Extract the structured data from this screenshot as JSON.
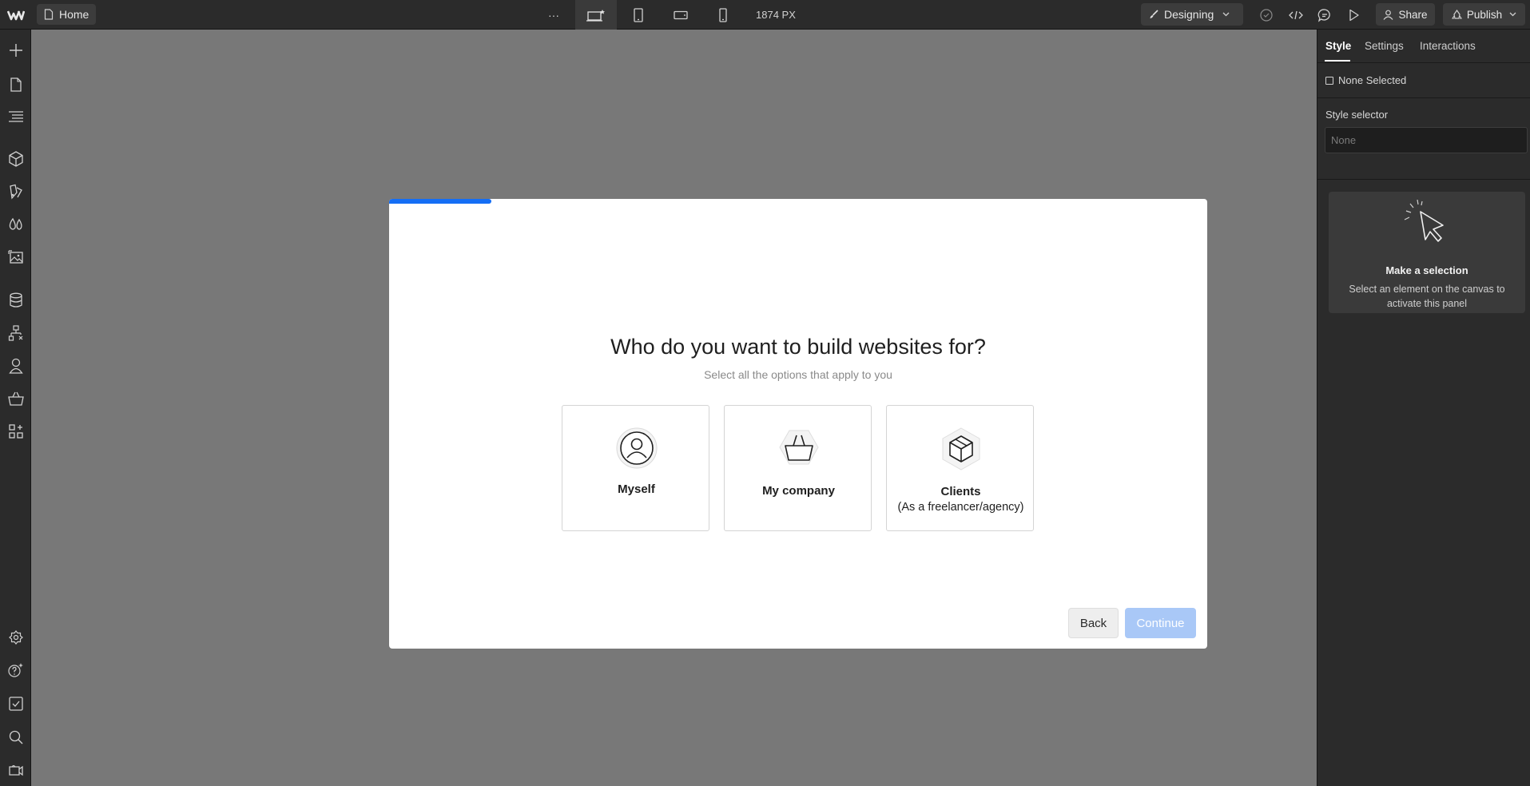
{
  "topbar": {
    "page_name": "Home",
    "more_label": "···",
    "viewport_width": "1874 PX",
    "mode_label": "Designing",
    "share_label": "Share",
    "publish_label": "Publish"
  },
  "modal": {
    "title": "Who do you want to build websites for?",
    "subtitle": "Select all the options that apply to you",
    "progress": 0.125,
    "options": [
      {
        "label": "Myself",
        "icon": "user-icon"
      },
      {
        "label": "My company",
        "icon": "basket-icon"
      },
      {
        "label": "Clients",
        "sublabel": "(As a freelancer/agency)",
        "icon": "box-icon"
      }
    ],
    "back_label": "Back",
    "continue_label": "Continue"
  },
  "right_panel": {
    "tabs": [
      "Style",
      "Settings",
      "Interactions"
    ],
    "active_tab": "Style",
    "selection_label": "None Selected",
    "style_selector_label": "Style selector",
    "style_selector_placeholder": "None",
    "empty_title": "Make a selection",
    "empty_desc": "Select an element on the canvas to activate this panel"
  },
  "colors": {
    "accent": "#146ef5",
    "continue_disabled": "#a9c8f7",
    "canvas": "#787878",
    "chrome": "#2b2b2b"
  }
}
